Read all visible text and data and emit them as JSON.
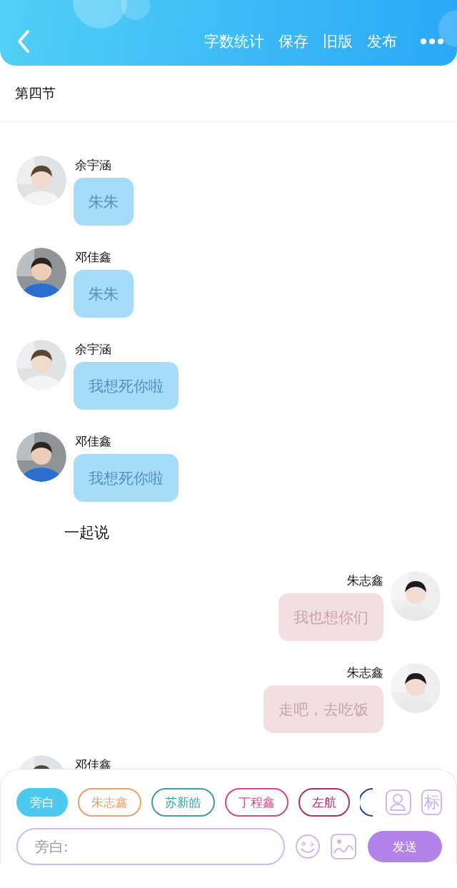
{
  "header": {
    "actions": [
      "字数统计",
      "保存",
      "旧版",
      "发布"
    ]
  },
  "chapter": {
    "title": "第四节"
  },
  "messages": [
    {
      "kind": "left",
      "name": "余宇涵",
      "text": "朱朱"
    },
    {
      "kind": "left",
      "name": "邓佳鑫",
      "text": "朱朱"
    },
    {
      "kind": "left",
      "name": "余宇涵",
      "text": "我想死你啦"
    },
    {
      "kind": "left",
      "name": "邓佳鑫",
      "text": "我想死你啦"
    },
    {
      "kind": "narration",
      "text": "一起说"
    },
    {
      "kind": "right",
      "name": "朱志鑫",
      "text": "我也想你们"
    },
    {
      "kind": "right",
      "name": "朱志鑫",
      "text": "走吧，去吃饭"
    },
    {
      "kind": "left",
      "name": "邓佳鑫"
    }
  ],
  "roles": [
    {
      "label": "旁白",
      "color": "#4cc9ef",
      "selected": true
    },
    {
      "label": "朱志鑫",
      "color": "#e8a06a",
      "selected": false
    },
    {
      "label": "苏新皓",
      "color": "#3f9fa0",
      "selected": false
    },
    {
      "label": "丁程鑫",
      "color": "#d8468a",
      "selected": false
    },
    {
      "label": "左航",
      "color": "#a8306e",
      "selected": false
    },
    {
      "color": "#1e3f8c",
      "selected": false
    }
  ],
  "tag_button": "标",
  "input": {
    "placeholder": "旁白:"
  },
  "send_button": "发送"
}
